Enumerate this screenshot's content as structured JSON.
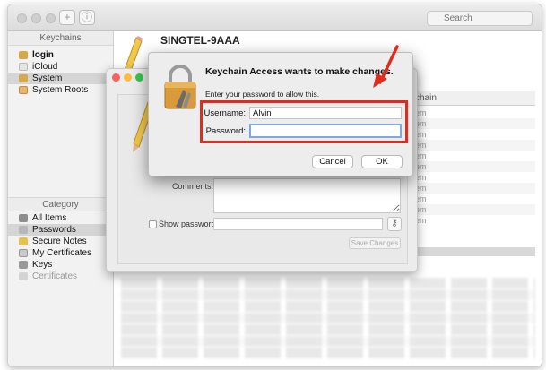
{
  "toolbar": {
    "search_placeholder": "Search"
  },
  "sidebar": {
    "keychains_header": "Keychains",
    "keychains": [
      {
        "label": "login"
      },
      {
        "label": "iCloud"
      },
      {
        "label": "System"
      },
      {
        "label": "System Roots"
      }
    ],
    "category_header": "Category",
    "categories": [
      {
        "label": "All Items"
      },
      {
        "label": "Passwords"
      },
      {
        "label": "Secure Notes"
      },
      {
        "label": "My Certificates"
      },
      {
        "label": "Keys"
      },
      {
        "label": "Certificates"
      }
    ]
  },
  "item": {
    "title": "SINGTEL-9AAA"
  },
  "list": {
    "column_header": "chain",
    "column_values": [
      "em",
      "em",
      "em",
      "em",
      "em",
      "em",
      "em",
      "em",
      "em",
      "em",
      "em"
    ]
  },
  "info_panel": {
    "comments_label": "Comments:",
    "show_password_label": "Show password:",
    "save_label": "Save Changes"
  },
  "dialog": {
    "title": "Keychain Access wants to make changes.",
    "subtitle": "Enter your password to allow this.",
    "username_label": "Username:",
    "username_value": "Alvin",
    "password_label": "Password:",
    "password_value": "",
    "cancel_label": "Cancel",
    "ok_label": "OK"
  },
  "colors": {
    "highlight_box": "#e22b1f",
    "focus_ring": "#7ea8e4",
    "traffic_red": "#fc605c",
    "traffic_yellow": "#fdbc40",
    "traffic_green": "#34c84a"
  }
}
